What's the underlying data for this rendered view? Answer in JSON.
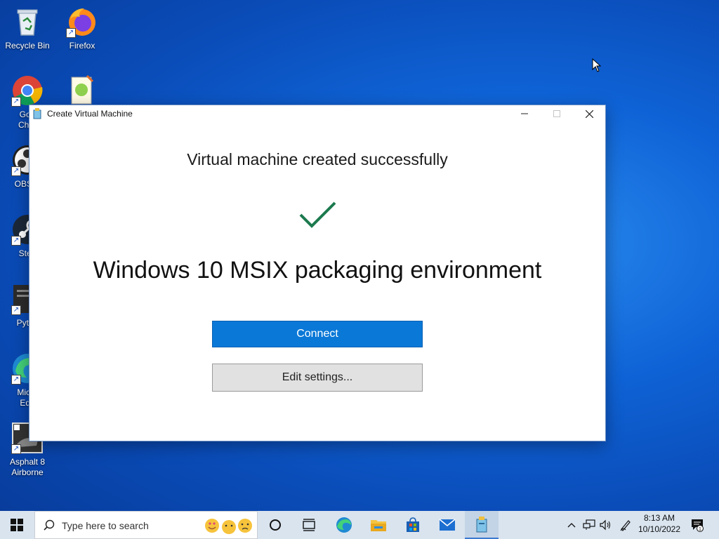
{
  "desktop": {
    "icons": [
      {
        "name": "recycle-bin",
        "label": "Recycle Bin"
      },
      {
        "name": "firefox",
        "label": "Firefox"
      },
      {
        "name": "chrome",
        "label": "Goo\nChro"
      },
      {
        "name": "notepadpp",
        "label": ""
      },
      {
        "name": "obs",
        "label": "OBS S"
      },
      {
        "name": "steam",
        "label": "Stea"
      },
      {
        "name": "python",
        "label": "Pytho"
      },
      {
        "name": "edge",
        "label": "Micro\nEdg"
      },
      {
        "name": "asphalt",
        "label": "Asphalt 8\nAirborne"
      }
    ]
  },
  "window": {
    "title": "Create Virtual Machine",
    "heading": "Virtual machine created successfully",
    "vm_name": "Windows 10 MSIX packaging environment",
    "connect_label": "Connect",
    "edit_label": "Edit settings..."
  },
  "taskbar": {
    "search_placeholder": "Type here to search",
    "time": "8:13 AM",
    "date": "10/10/2022",
    "notification_count": "1",
    "accent": "#0a78d7"
  }
}
